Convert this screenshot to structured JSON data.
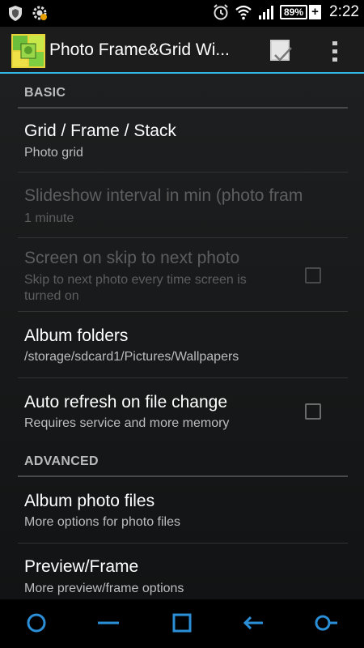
{
  "status_bar": {
    "time": "2:22",
    "battery_percent": "89%",
    "charging_symbol": "+",
    "icons": [
      "shield-icon",
      "gear-badge-icon",
      "alarm-clock-icon",
      "wifi-icon",
      "signal-icon",
      "battery-icon"
    ]
  },
  "action_bar": {
    "title": "Photo Frame&Grid Wi...",
    "actions": [
      "done-checkmark-icon",
      "overflow-menu-icon"
    ]
  },
  "sections": {
    "basic": {
      "header": "BASIC"
    },
    "advanced": {
      "header": "ADVANCED"
    }
  },
  "prefs": {
    "grid_frame_stack": {
      "title": "Grid / Frame / Stack",
      "summary": "Photo grid",
      "enabled": true
    },
    "slideshow_interval": {
      "title": "Slideshow interval in min (photo fram",
      "summary": "1 minute",
      "enabled": false
    },
    "screen_on_skip": {
      "title": "Screen on skip to next photo",
      "summary_line1": "Skip to next photo every time screen is",
      "summary_line2": "turned on",
      "enabled": false,
      "checked": false
    },
    "album_folders": {
      "title": "Album folders",
      "summary": "/storage/sdcard1/Pictures/Wallpapers",
      "enabled": true
    },
    "auto_refresh": {
      "title": "Auto refresh on file change",
      "summary": "Requires service and more memory",
      "enabled": true,
      "checked": false
    },
    "album_photo_files": {
      "title": "Album photo files",
      "summary": "More options for photo files",
      "enabled": true
    },
    "preview_frame": {
      "title": "Preview/Frame",
      "summary": "More preview/frame options",
      "enabled": true
    }
  },
  "nav_bar": {
    "buttons": [
      "circle-home-icon",
      "minus-icon",
      "square-recents-icon",
      "back-arrow-icon",
      "circle-key-icon"
    ]
  },
  "colors": {
    "accent": "#33b5e5",
    "nav_icon": "#2b8fd8",
    "background": "#1a1c1d"
  }
}
